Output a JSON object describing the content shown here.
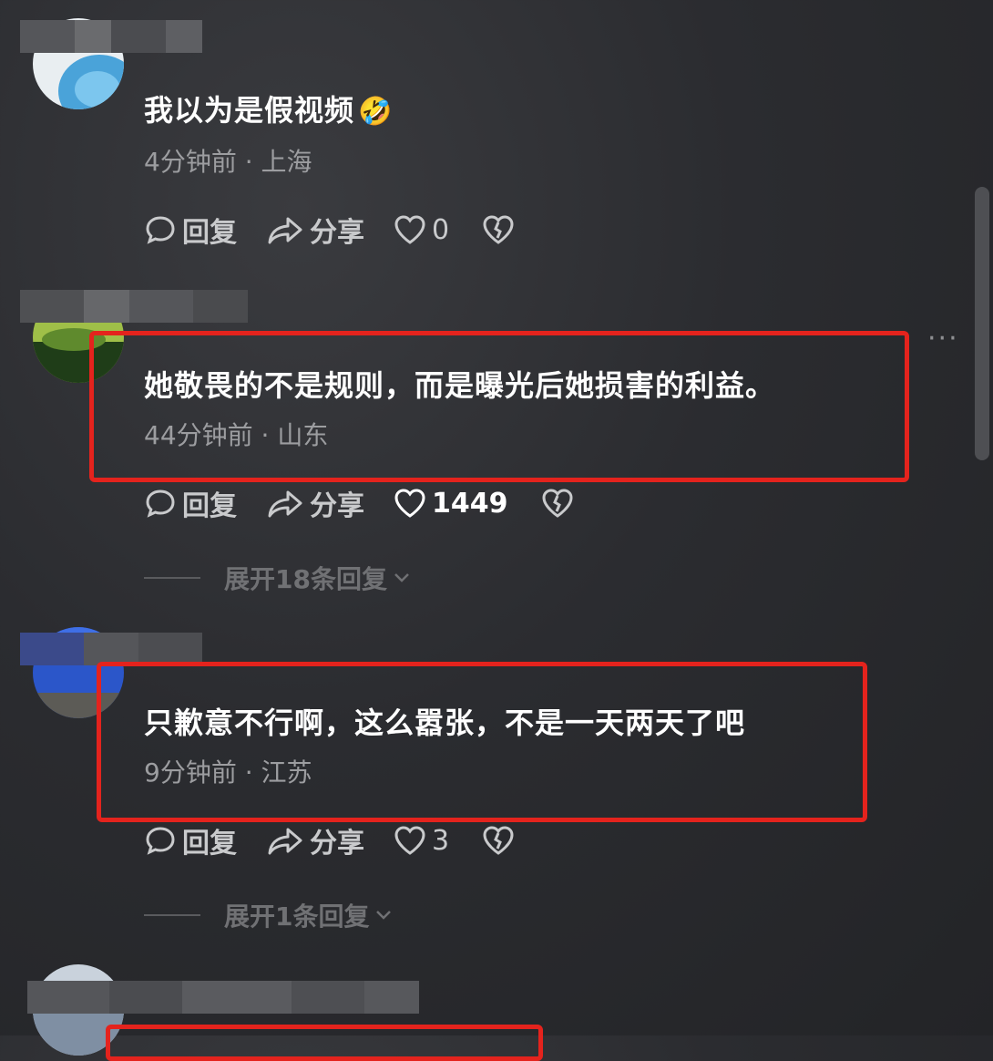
{
  "comments": [
    {
      "text": "我以为是假视频",
      "emoji": "🤣",
      "meta": "4分钟前 · 上海",
      "reply_label": "回复",
      "share_label": "分享",
      "likes": "0"
    },
    {
      "text": "她敬畏的不是规则，而是曝光后她损害的利益。",
      "meta": "44分钟前 · 山东",
      "reply_label": "回复",
      "share_label": "分享",
      "likes": "1449",
      "expand_label": "展开18条回复"
    },
    {
      "text": "只歉意不行啊，这么嚣张，不是一天两天了吧",
      "meta": "9分钟前 · 江苏",
      "reply_label": "回复",
      "share_label": "分享",
      "likes": "3",
      "expand_label": "展开1条回复"
    }
  ],
  "more_menu": "···",
  "colors": {
    "highlight": "#e4231d",
    "text": "#ffffff",
    "meta": "#9c9da0"
  },
  "icons": [
    "comment-bubble-icon",
    "share-arrow-icon",
    "heart-icon",
    "broken-heart-icon",
    "chevron-down-icon"
  ]
}
